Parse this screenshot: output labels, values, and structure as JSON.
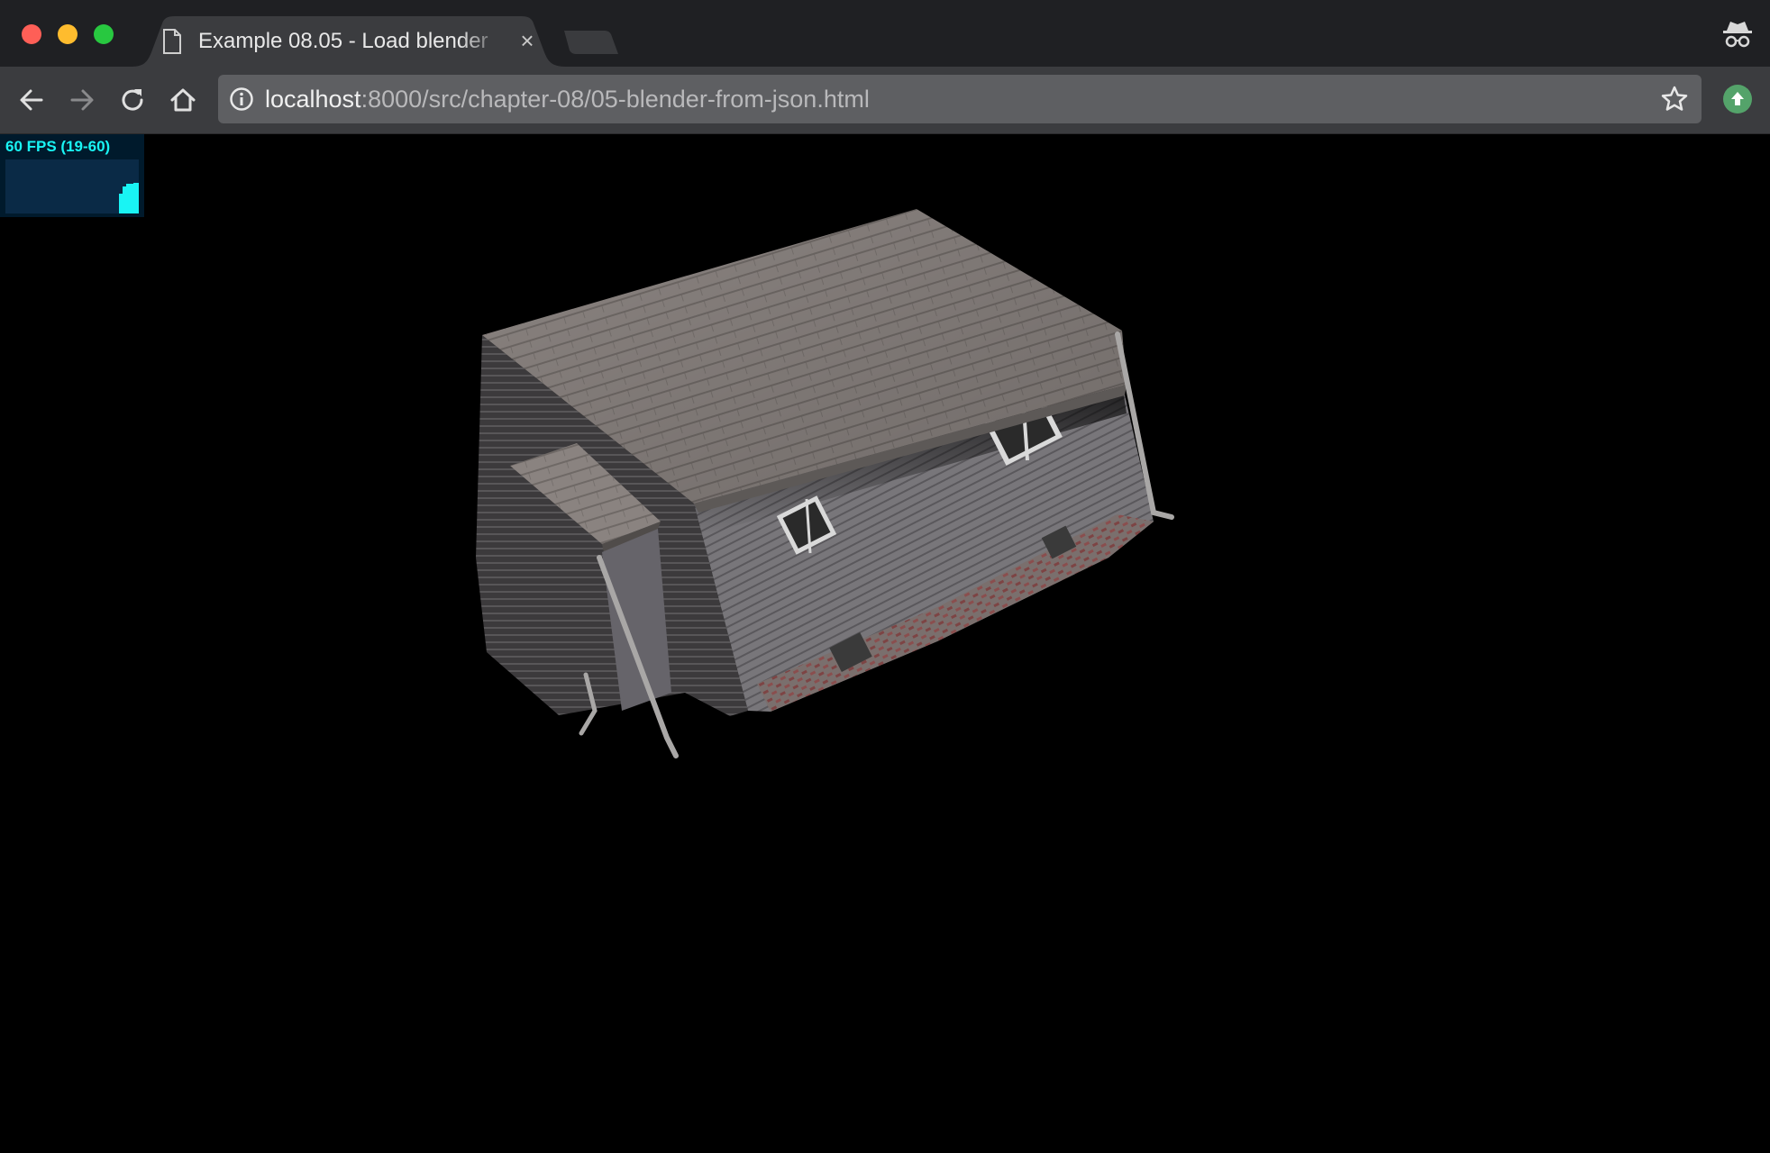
{
  "window": {
    "tab": {
      "title": "Example 08.05 - Load blender",
      "close_glyph": "×",
      "icon": "document-icon"
    }
  },
  "toolbar": {
    "url_host": "localhost",
    "url_path": ":8000/src/chapter-08/05-blender-from-json.html",
    "icons": [
      "back-arrow-icon",
      "forward-arrow-icon",
      "reload-icon",
      "home-icon",
      "info-icon",
      "star-icon",
      "extension-icon",
      "incognito-icon"
    ]
  },
  "stats": {
    "fps_label": "60 FPS (19-60)",
    "fps_current": 60,
    "fps_min": 19,
    "fps_max": 60
  },
  "colors": {
    "titlebar": "#1f2023",
    "toolbar": "#3b3c3f",
    "omnibox": "#5e5f62",
    "stats_text": "#19f4f4",
    "stats_bg": "#001a2c",
    "viewport_bg": "#000000"
  }
}
